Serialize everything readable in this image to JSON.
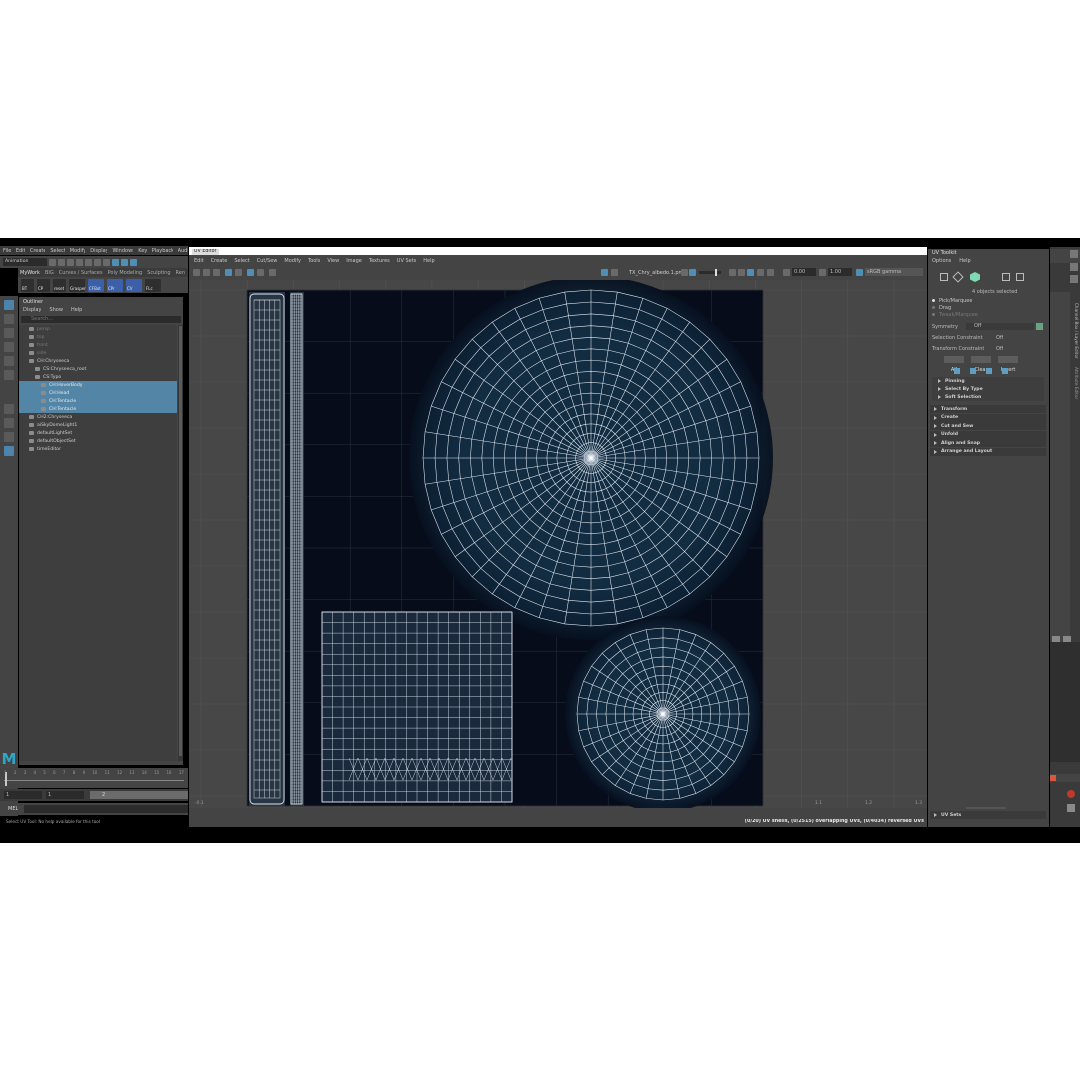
{
  "main_menu": [
    "File",
    "Edit",
    "Create",
    "Select",
    "Modify",
    "Display",
    "Windows",
    "Key",
    "Playback",
    "Audi"
  ],
  "mode_dropdown": "Animation",
  "shelf": {
    "workspace": "MyWork",
    "tabs": [
      "BIG",
      "Curves / Surfaces",
      "Poly Modeling",
      "Sculpting",
      "Ren"
    ],
    "icon_labels": [
      "BT",
      "CP",
      "reset",
      "Grasper",
      "CFBot",
      "CPr",
      "CV",
      "FLc"
    ]
  },
  "outliner": {
    "title": "Outliner",
    "menu": [
      "Display",
      "Show",
      "Help"
    ],
    "search_placeholder": "Search...",
    "items": [
      {
        "label": "persp",
        "selected": false,
        "indent": 1,
        "dim": true
      },
      {
        "label": "top",
        "selected": false,
        "indent": 1,
        "dim": true
      },
      {
        "label": "front",
        "selected": false,
        "indent": 1,
        "dim": true
      },
      {
        "label": "side",
        "selected": false,
        "indent": 1,
        "dim": true
      },
      {
        "label": "CH:Chryseeca",
        "selected": false,
        "indent": 1,
        "dim": false
      },
      {
        "label": "CS:Chryseeca_root",
        "selected": false,
        "indent": 2,
        "dim": false
      },
      {
        "label": "CS:Typo",
        "selected": false,
        "indent": 2,
        "dim": false
      },
      {
        "label": "CH:HoverBody",
        "selected": true,
        "indent": 3,
        "dim": false
      },
      {
        "label": "CH:Head",
        "selected": true,
        "indent": 3,
        "dim": false
      },
      {
        "label": "CH:Tentacle",
        "selected": true,
        "indent": 3,
        "dim": false
      },
      {
        "label": "CH:Tentacle",
        "selected": true,
        "indent": 3,
        "dim": false
      },
      {
        "label": "CH2:Chryseeca",
        "selected": false,
        "indent": 1,
        "dim": false
      },
      {
        "label": "aiSkyDomeLight1",
        "selected": false,
        "indent": 1,
        "dim": false
      },
      {
        "label": "defaultLightSet",
        "selected": false,
        "indent": 1,
        "dim": false
      },
      {
        "label": "defaultObjectSet",
        "selected": false,
        "indent": 1,
        "dim": false
      },
      {
        "label": "timeEditor",
        "selected": false,
        "indent": 1,
        "dim": false
      }
    ]
  },
  "timeline_ticks": [
    "1",
    "2",
    "3",
    "4",
    "5",
    "6",
    "7",
    "8",
    "9",
    "10",
    "11",
    "12",
    "13",
    "14",
    "15",
    "16",
    "17"
  ],
  "range": {
    "start": "1",
    "start2": "1",
    "end": "2"
  },
  "command_line": {
    "label": "MEL",
    "help": "Select UV Tool: No help available for this tool"
  },
  "uv_editor": {
    "title": "UV Editor",
    "menu": [
      "Edit",
      "Create",
      "Select",
      "Cut/Sew",
      "Modify",
      "Tools",
      "View",
      "Image",
      "Textures",
      "UV Sets",
      "Help"
    ],
    "texture_name": "TX_Chry_albedo.1.png",
    "exposure": "0.00",
    "gamma": "1.00",
    "color_space": "sRGB gamma",
    "axis_labels": {
      "left": "-0.1",
      "r1": "1.1",
      "r2": "1.2",
      "r3": "1.3"
    },
    "status": "(0/20) UV shells, (0/2515) overlapping UVs, (0/4034) reversed UVs"
  },
  "uv_toolkit": {
    "title": "UV Toolkit",
    "menu": [
      "Options",
      "Help"
    ],
    "selection_info": "4 objects selected",
    "pick_modes": [
      "Pick/Marquee",
      "Drag",
      "Tweak/Marquee"
    ],
    "symmetry_label": "Symmetry",
    "symmetry_value": "Off",
    "selection_constraint_label": "Selection Constraint",
    "selection_constraint_value": "Off",
    "transform_constraint_label": "Transform Constraint",
    "transform_constraint_value": "Off",
    "buttons": [
      "All",
      "Clear",
      "Invert"
    ],
    "subsections": [
      "Pinning",
      "Select By Type",
      "Soft Selection"
    ],
    "sections": [
      "Transform",
      "Create",
      "Cut and Sew",
      "Unfold",
      "Align and Snap",
      "Arrange and Layout"
    ],
    "footer": "UV Sets"
  },
  "right_tabs": [
    "Channel Box / Layer Editor",
    "Attribute Editor"
  ],
  "colors": {
    "accent": "#5285a6",
    "panel": "#444444",
    "canvas": "#060c1a",
    "wire": "#e6edf5"
  }
}
